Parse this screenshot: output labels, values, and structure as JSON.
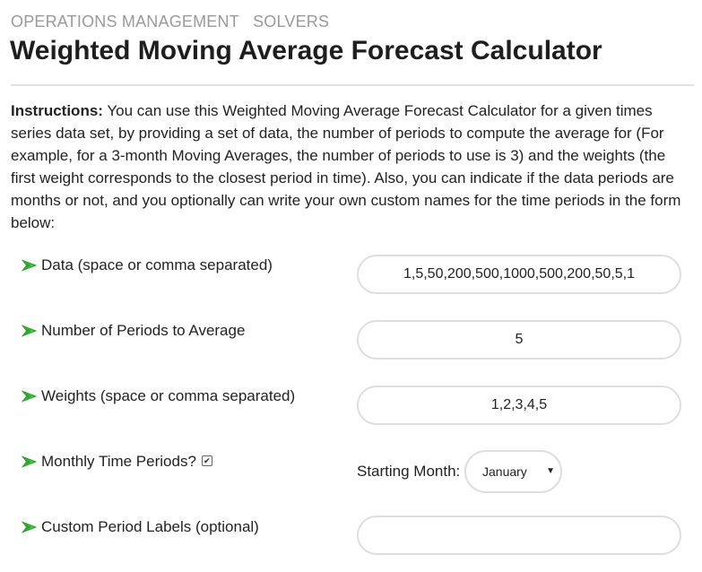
{
  "breadcrumb": [
    "OPERATIONS MANAGEMENT",
    "SOLVERS"
  ],
  "page_title": "Weighted Moving Average Forecast Calculator",
  "instructions": {
    "label": "Instructions:",
    "text": " You can use this Weighted Moving Average Forecast Calculator for a given times series data set, by providing a set of data, the number of periods to compute the average for (For example, for a 3-month Moving Averages, the number of periods to use is 3) and the weights (the first weight corresponds to the closest period in time). Also, you can indicate if the data periods are months or not, and you optionally can write your own custom names for the time periods in the form below:"
  },
  "form": {
    "data": {
      "label": "Data (space or comma separated)",
      "value": "1,5,50,200,500,1000,500,200,50,5,1"
    },
    "periods": {
      "label": "Number of Periods to Average",
      "value": "5"
    },
    "weights": {
      "label": "Weights (space or comma separated)",
      "value": "1,2,3,4,5"
    },
    "monthly": {
      "label": "Monthly Time Periods?",
      "checked": true,
      "check_glyph": "✔"
    },
    "starting_month": {
      "label": "Starting Month:",
      "selected": "January"
    },
    "custom_labels": {
      "label": "Custom Period Labels (optional)",
      "value": ""
    }
  },
  "colors": {
    "arrow": "#2aa52a",
    "input_border": "#dedede",
    "muted": "#9a9a9a"
  }
}
